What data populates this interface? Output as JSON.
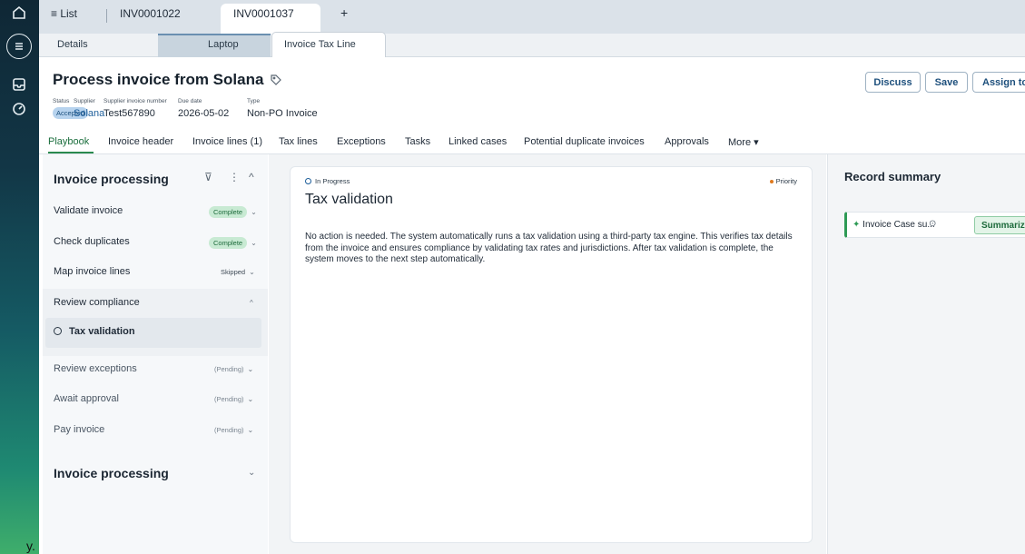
{
  "rail": {
    "fragment": "y."
  },
  "doc_tabs": {
    "list": "≡ List",
    "tab1": "INV0001022",
    "tab2": "INV0001037",
    "add": "+"
  },
  "sub_tabs": {
    "details": "Details",
    "laptop": "Laptop",
    "invoice_tax_line": "Invoice Tax Line"
  },
  "header": {
    "title": "Process invoice from Solana",
    "status_label": "Status",
    "status_value": "Accepted",
    "supplier_label": "Supplier",
    "supplier_value": "Solana",
    "sin_label": "Supplier invoice number",
    "sin_value": "Test567890",
    "due_label": "Due date",
    "due_value": "2026-05-02",
    "type_label": "Type",
    "type_value": "Non-PO Invoice",
    "discuss": "Discuss",
    "save": "Save",
    "assign": "Assign to"
  },
  "nav": [
    "Playbook",
    "Invoice header",
    "Invoice lines (1)",
    "Tax lines",
    "Exceptions",
    "Tasks",
    "Linked cases",
    "Potential duplicate invoices",
    "Approvals",
    "More ▾"
  ],
  "playbook": {
    "title": "Invoice processing",
    "steps": [
      {
        "label": "Validate invoice",
        "status": "Complete"
      },
      {
        "label": "Check duplicates",
        "status": "Complete"
      },
      {
        "label": "Map invoice lines",
        "status": "Skipped"
      },
      {
        "label": "Review compliance",
        "status": ""
      },
      {
        "label": "Tax validation",
        "status": ""
      },
      {
        "label": "Review exceptions",
        "status": "(Pending)"
      },
      {
        "label": "Await approval",
        "status": "(Pending)"
      },
      {
        "label": "Pay invoice",
        "status": "(Pending)"
      }
    ],
    "title2": "Invoice processing"
  },
  "task": {
    "state": "In Progress",
    "priority": "Priority",
    "title": "Tax validation",
    "body": "No action is needed. The system automatically runs a tax validation using a third-party tax engine. This verifies tax details from the invoice and ensures compliance by validating tax rates and jurisdictions. After tax validation is complete, the system moves to the next step automatically."
  },
  "summary": {
    "title": "Record summary",
    "item": "Invoice Case su...",
    "button": "Summariz"
  },
  "colors": {
    "accent": "#2a8a4e",
    "link": "#1d5e9a",
    "priority": "#e07a1f"
  }
}
